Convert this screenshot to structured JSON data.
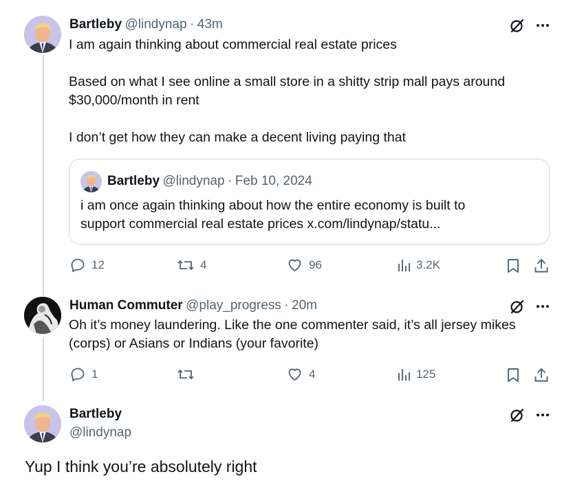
{
  "tweet1": {
    "name": "Bartleby",
    "handle": "@lindynap",
    "sep": "·",
    "time": "43m",
    "lines": [
      "I am again thinking about commercial real estate prices",
      "Based on what I see online a small store in a shitty strip mall pays around",
      "$30,000/month in rent",
      "I don’t get how they can make a decent living paying that"
    ],
    "quote": {
      "name": "Bartleby",
      "handle": "@lindynap",
      "sep": "·",
      "date": "Feb 10, 2024",
      "line1": "i am once again thinking about how the entire economy is built to",
      "line2": "support commercial real estate prices x.com/lindynap/statu..."
    },
    "actions": {
      "replies": "12",
      "reposts": "4",
      "likes": "96",
      "views": "3.2K"
    }
  },
  "tweet2": {
    "name": "Human Commuter",
    "handle": "@play_progress",
    "sep": "·",
    "time": "20m",
    "line1": "Oh it’s money laundering. Like the one commenter said, it’s all jersey mikes",
    "line2": "(corps) or Asians or Indians (your favorite)",
    "actions": {
      "replies": "1",
      "reposts": "",
      "likes": "4",
      "views": "125"
    }
  },
  "tweet3": {
    "name": "Bartleby",
    "handle": "@lindynap",
    "text": "Yup I think you’re absolutely right"
  },
  "icons": {
    "grok": "grok-slash-icon",
    "more": "more-dots-icon",
    "reply": "reply-bubble-icon",
    "repost": "repost-arrows-icon",
    "like": "heart-icon",
    "views": "views-bars-icon",
    "bookmark": "bookmark-icon",
    "share": "share-upload-icon"
  },
  "colors": {
    "text": "#0f1419",
    "muted": "#536471",
    "line": "#cfd9de",
    "bg": "#ffffff"
  }
}
